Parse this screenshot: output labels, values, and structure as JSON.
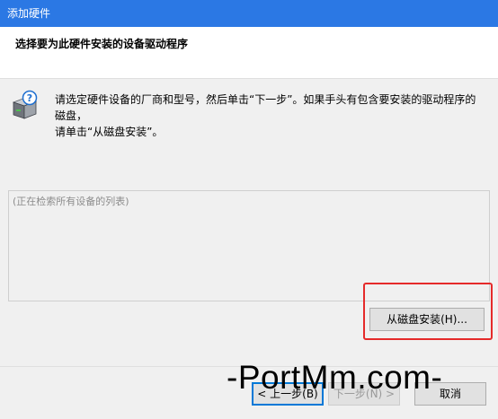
{
  "window": {
    "title": "添加硬件"
  },
  "header": {
    "title": "选择要为此硬件安装的设备驱动程序"
  },
  "instruction": {
    "icon": "hardware-device-question-icon",
    "line1": "请选定硬件设备的厂商和型号，然后单击“下一步”。如果手头有包含要安装的驱动程序的磁盘，",
    "line2": "请单击“从磁盘安装”。"
  },
  "device_list": {
    "status_text": "(正在检索所有设备的列表)"
  },
  "buttons": {
    "have_disk": "从磁盘安装(H)...",
    "back": "< 上一步(B)",
    "next": "下一步(N) >",
    "cancel": "取消"
  },
  "annotation": {
    "highlight_color": "#e52a2a"
  },
  "watermark": "-PortMm.com-"
}
